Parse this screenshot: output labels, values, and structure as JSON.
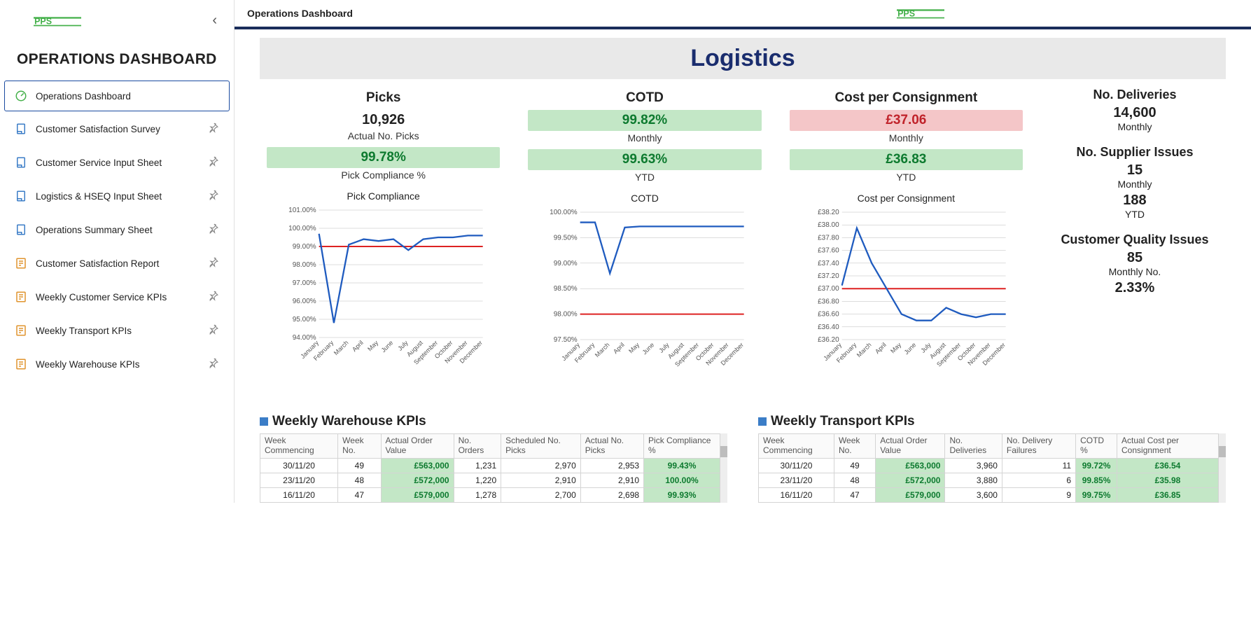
{
  "sidebar": {
    "title": "OPERATIONS DASHBOARD",
    "items": [
      {
        "label": "Operations Dashboard",
        "icon": "gauge",
        "color": "#43b049",
        "active": true,
        "pinned": false
      },
      {
        "label": "Customer Satisfaction Survey",
        "icon": "sheet",
        "color": "#3b7dc7",
        "active": false,
        "pinned": true
      },
      {
        "label": "Customer Service Input Sheet",
        "icon": "sheet",
        "color": "#3b7dc7",
        "active": false,
        "pinned": true
      },
      {
        "label": "Logistics & HSEQ Input Sheet",
        "icon": "sheet",
        "color": "#3b7dc7",
        "active": false,
        "pinned": true
      },
      {
        "label": "Operations Summary Sheet",
        "icon": "sheet",
        "color": "#3b7dc7",
        "active": false,
        "pinned": true
      },
      {
        "label": "Customer Satisfaction Report",
        "icon": "report",
        "color": "#e0942e",
        "active": false,
        "pinned": true
      },
      {
        "label": "Weekly Customer Service KPIs",
        "icon": "report",
        "color": "#e0942e",
        "active": false,
        "pinned": true
      },
      {
        "label": "Weekly Transport KPIs",
        "icon": "report",
        "color": "#e0942e",
        "active": false,
        "pinned": true
      },
      {
        "label": "Weekly Warehouse KPIs",
        "icon": "report",
        "color": "#e0942e",
        "active": false,
        "pinned": true
      }
    ]
  },
  "header": {
    "breadcrumb": "Operations Dashboard"
  },
  "section_title": "Logistics",
  "kpis": {
    "picks": {
      "title": "Picks",
      "value": "10,926",
      "value_label": "Actual No. Picks",
      "secondary": "99.78%",
      "secondary_label": "Pick Compliance %",
      "secondary_status": "green"
    },
    "cotd": {
      "title": "COTD",
      "monthly": "99.82%",
      "monthly_label": "Monthly",
      "monthly_status": "green",
      "ytd": "99.63%",
      "ytd_label": "YTD",
      "ytd_status": "green"
    },
    "cost": {
      "title": "Cost per Consignment",
      "monthly": "£37.06",
      "monthly_label": "Monthly",
      "monthly_status": "red",
      "ytd": "£36.83",
      "ytd_label": "YTD",
      "ytd_status": "green"
    }
  },
  "right": {
    "deliveries": {
      "title": "No. Deliveries",
      "value": "14,600",
      "label": "Monthly"
    },
    "supplier": {
      "title": "No. Supplier Issues",
      "monthly": "15",
      "monthly_label": "Monthly",
      "ytd": "188",
      "ytd_label": "YTD"
    },
    "quality": {
      "title": "Customer Quality Issues",
      "monthly": "85",
      "monthly_label": "Monthly No.",
      "pct": "2.33%"
    }
  },
  "chart_data": [
    {
      "id": "pick",
      "type": "line",
      "title": "Pick Compliance",
      "categories": [
        "January",
        "February",
        "March",
        "April",
        "May",
        "June",
        "July",
        "August",
        "September",
        "October",
        "November",
        "December"
      ],
      "values": [
        99.7,
        94.8,
        99.1,
        99.4,
        99.3,
        99.4,
        98.8,
        99.4,
        99.5,
        99.5,
        99.6,
        99.6
      ],
      "reference": 99.0,
      "ylabel": "%",
      "yticks": [
        "94.00%",
        "95.00%",
        "96.00%",
        "97.00%",
        "98.00%",
        "99.00%",
        "100.00%",
        "101.00%"
      ],
      "ylim": [
        94,
        101
      ]
    },
    {
      "id": "cotd",
      "type": "line",
      "title": "COTD",
      "categories": [
        "January",
        "February",
        "March",
        "April",
        "May",
        "June",
        "July",
        "August",
        "September",
        "October",
        "November",
        "December"
      ],
      "values": [
        99.8,
        99.8,
        98.8,
        99.7,
        99.72,
        99.72,
        99.72,
        99.72,
        99.72,
        99.72,
        99.72,
        99.72
      ],
      "reference": 98.0,
      "ylabel": "%",
      "yticks": [
        "97.50%",
        "98.00%",
        "98.50%",
        "99.00%",
        "99.50%",
        "100.00%"
      ],
      "ylim": [
        97.5,
        100
      ]
    },
    {
      "id": "cost",
      "type": "line",
      "title": "Cost per Consignment",
      "categories": [
        "January",
        "February",
        "March",
        "April",
        "May",
        "June",
        "July",
        "August",
        "September",
        "October",
        "November",
        "December"
      ],
      "values": [
        37.05,
        37.95,
        37.4,
        37.0,
        36.6,
        36.5,
        36.5,
        36.7,
        36.6,
        36.55,
        36.6,
        36.6
      ],
      "reference": 37.0,
      "ylabel": "£",
      "yticks": [
        "£36.20",
        "£36.40",
        "£36.60",
        "£36.80",
        "£37.00",
        "£37.20",
        "£37.40",
        "£37.60",
        "£37.80",
        "£38.00",
        "£38.20"
      ],
      "ylim": [
        36.2,
        38.2
      ]
    }
  ],
  "warehouse_table": {
    "title": "Weekly Warehouse KPIs",
    "headers": [
      "Week Commencing",
      "Week No.",
      "Actual Order Value",
      "No. Orders",
      "Scheduled No. Picks",
      "Actual No. Picks",
      "Pick Compliance %"
    ],
    "rows": [
      [
        "30/11/20",
        "49",
        "£563,000",
        "1,231",
        "2,970",
        "2,953",
        "99.43%"
      ],
      [
        "23/11/20",
        "48",
        "£572,000",
        "1,220",
        "2,910",
        "2,910",
        "100.00%"
      ],
      [
        "16/11/20",
        "47",
        "£579,000",
        "1,278",
        "2,700",
        "2,698",
        "99.93%"
      ]
    ]
  },
  "transport_table": {
    "title": "Weekly Transport KPIs",
    "headers": [
      "Week Commencing",
      "Week No.",
      "Actual Order Value",
      "No. Deliveries",
      "No. Delivery Failures",
      "COTD %",
      "Actual Cost per Consignment"
    ],
    "rows": [
      [
        "30/11/20",
        "49",
        "£563,000",
        "3,960",
        "11",
        "99.72%",
        "£36.54"
      ],
      [
        "23/11/20",
        "48",
        "£572,000",
        "3,880",
        "6",
        "99.85%",
        "£35.98"
      ],
      [
        "16/11/20",
        "47",
        "£579,000",
        "3,600",
        "9",
        "99.75%",
        "£36.85"
      ]
    ]
  }
}
